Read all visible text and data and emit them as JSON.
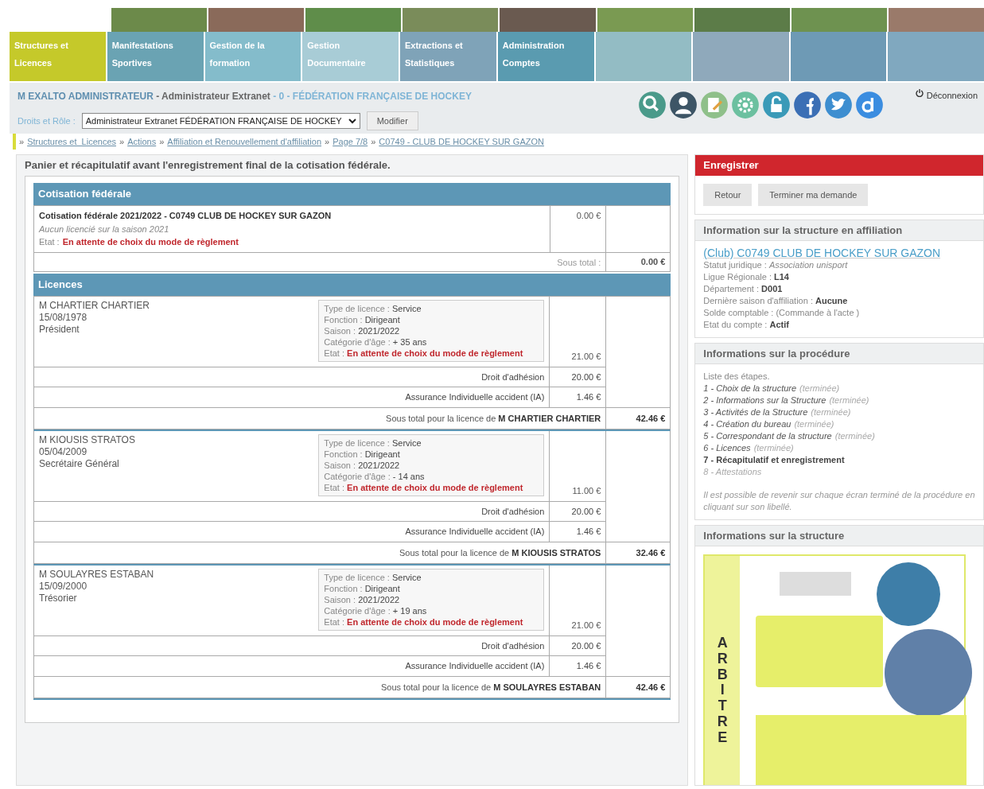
{
  "nav_tabs": [
    {
      "label": "Structures et Licences",
      "selected": true
    },
    {
      "label": "Manifestations Sportives",
      "selected": false
    },
    {
      "label": "Gestion de la formation",
      "selected": false
    },
    {
      "label": "Gestion Documentaire",
      "selected": false
    },
    {
      "label": "Extractions et Statistiques",
      "selected": false
    },
    {
      "label": "Administration Comptes",
      "selected": false
    }
  ],
  "user_bar": {
    "parts": [
      {
        "text": "M EXALTO ADMINISTRATEUR",
        "kind": "name"
      },
      {
        "text": " - Administrateur Extranet",
        "kind": "role"
      },
      {
        "text": " - 0 - FÉDÉRATION FRANÇAISE DE HOCKEY",
        "kind": "org"
      }
    ],
    "rights_label": "Droits et Rôle :",
    "rights_value": "Administrateur Extranet FÉDÉRATION FRANÇAISE DE HOCKEY",
    "modify_button": "Modifier",
    "logout": "Déconnexion"
  },
  "breadcrumb": {
    "separator": "»",
    "items": [
      "Structures et  Licences",
      "Actions",
      "Affiliation et Renouvellement d'affiliation",
      "Page 7/8",
      "C0749 - CLUB DE HOCKEY SUR GAZON"
    ]
  },
  "main": {
    "title": "Panier et récapitulatif avant l'enregistrement final de la cotisation fédérale.",
    "cotisation": {
      "header": "Cotisation fédérale",
      "title": "Cotisation fédérale 2021/2022 - C0749 CLUB DE HOCKEY SUR GAZON",
      "note": "Aucun licencié sur la saison 2021",
      "state_label": "Etat :",
      "state": "En attente de choix du mode de règlement",
      "amount": "0.00 €",
      "subtotal_label": "Sous total :",
      "subtotal": "0.00 €"
    },
    "licences_header": "Licences",
    "licences": [
      {
        "name": "M CHARTIER CHARTIER",
        "birth": "15/08/1978",
        "role": "Président",
        "details": [
          {
            "label": "Type de licence :",
            "value": "Service",
            "kind": "plain"
          },
          {
            "label": "Fonction :",
            "value": "Dirigeant",
            "kind": "plain"
          },
          {
            "label": "Saison :",
            "value": "2021/2022",
            "kind": "plain"
          },
          {
            "label": "Catégorie d'âge :",
            "value": "+ 35 ans",
            "kind": "plain"
          },
          {
            "label": "Etat :",
            "value": "En attente de choix du mode de règlement",
            "kind": "alert"
          }
        ],
        "amount": "21.00 €",
        "fees": [
          {
            "label": "Droit d'adhésion",
            "amount": "20.00 €"
          },
          {
            "label": "Assurance Individuelle accident (IA)",
            "amount": "1.46 €"
          }
        ],
        "subtotal_label": "Sous total pour la licence de",
        "subtotal_name": "M CHARTIER CHARTIER",
        "subtotal": "42.46 €"
      },
      {
        "name": "M KIOUSIS STRATOS",
        "birth": "05/04/2009",
        "role": "Secrétaire Général",
        "details": [
          {
            "label": "Type de licence :",
            "value": "Service",
            "kind": "plain"
          },
          {
            "label": "Fonction :",
            "value": "Dirigeant",
            "kind": "plain"
          },
          {
            "label": "Saison :",
            "value": "2021/2022",
            "kind": "plain"
          },
          {
            "label": "Catégorie d'âge :",
            "value": "- 14 ans",
            "kind": "plain"
          },
          {
            "label": "Etat :",
            "value": "En attente de choix du mode de règlement",
            "kind": "alert"
          }
        ],
        "amount": "11.00 €",
        "fees": [
          {
            "label": "Droit d'adhésion",
            "amount": "20.00 €"
          },
          {
            "label": "Assurance Individuelle accident (IA)",
            "amount": "1.46 €"
          }
        ],
        "subtotal_label": "Sous total pour la licence de",
        "subtotal_name": "M KIOUSIS STRATOS",
        "subtotal": "32.46 €"
      },
      {
        "name": "M SOULAYRES ESTABAN",
        "birth": "15/09/2000",
        "role": "Trésorier",
        "details": [
          {
            "label": "Type de licence :",
            "value": "Service",
            "kind": "plain"
          },
          {
            "label": "Fonction :",
            "value": "Dirigeant",
            "kind": "plain"
          },
          {
            "label": "Saison :",
            "value": "2021/2022",
            "kind": "plain"
          },
          {
            "label": "Catégorie d'âge :",
            "value": "+ 19 ans",
            "kind": "plain"
          },
          {
            "label": "Etat :",
            "value": "En attente de choix du mode de règlement",
            "kind": "alert"
          }
        ],
        "amount": "21.00 €",
        "fees": [
          {
            "label": "Droit d'adhésion",
            "amount": "20.00 €"
          },
          {
            "label": "Assurance Individuelle accident (IA)",
            "amount": "1.46 €"
          }
        ],
        "subtotal_label": "Sous total pour la licence de",
        "subtotal_name": "M SOULAYRES ESTABAN",
        "subtotal": "42.46 €"
      }
    ]
  },
  "save_panel": {
    "title": "Enregistrer",
    "buttons": [
      "Retour",
      "Terminer ma demande"
    ]
  },
  "structure_info": {
    "title": "Information sur la structure en affiliation",
    "club_link": "(Club) C0749 CLUB DE HOCKEY SUR GAZON",
    "fields": [
      {
        "label": "Statut juridique :",
        "value": "Association unisport",
        "kind": "italic"
      },
      {
        "label": "Ligue Régionale :",
        "value": "L14",
        "kind": "bold"
      },
      {
        "label": "Département :",
        "value": "D001",
        "kind": "bold"
      },
      {
        "label": "Dernière saison d'affiliation :",
        "value": "Aucune",
        "kind": "bold"
      },
      {
        "label": "Solde comptable :",
        "value": "(Commande à l'acte )",
        "kind": "plain"
      },
      {
        "label": "Etat du compte :",
        "value": "Actif",
        "kind": "bold"
      }
    ]
  },
  "procedure": {
    "title": "Informations sur la procédure",
    "intro": "Liste des étapes.",
    "steps": [
      {
        "text": "1 - Choix de la structure",
        "status": "(terminée)",
        "kind": "done"
      },
      {
        "text": "2 - Informations sur la Structure",
        "status": "(terminée)",
        "kind": "done"
      },
      {
        "text": "3 - Activités de la Structure",
        "status": "(terminée)",
        "kind": "done"
      },
      {
        "text": "4 - Création du bureau",
        "status": "(terminée)",
        "kind": "done"
      },
      {
        "text": "5 - Correspondant de la structure",
        "status": "(terminée)",
        "kind": "done"
      },
      {
        "text": "6 - Licences",
        "status": "(terminée)",
        "kind": "done"
      },
      {
        "text": "7 - Récapitulatif et enregistrement",
        "kind": "current"
      },
      {
        "text": "8 - Attestations",
        "kind": "pending"
      }
    ],
    "note": "Il est possible de revenir sur chaque écran terminé de la procédure en cliquant sur son libellé."
  },
  "structure_panel": {
    "title": "Informations sur la structure",
    "flyer_title": "ARBITRE"
  }
}
